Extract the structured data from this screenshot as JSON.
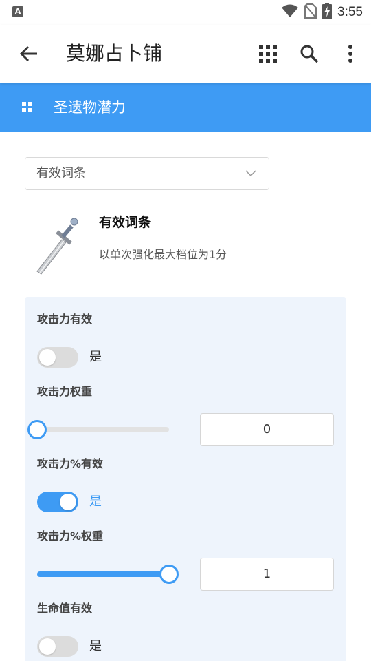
{
  "status_bar": {
    "time": "3:55",
    "notification_icon": "A",
    "icons": [
      "wifi-icon",
      "no-sim-icon",
      "battery-charging-icon"
    ]
  },
  "app_bar": {
    "title": "莫娜占卜铺",
    "icons": [
      "back-arrow-icon",
      "grid-icon",
      "search-icon",
      "more-vert-icon"
    ]
  },
  "section": {
    "title": "圣遗物潜力",
    "icon": "grid-small-icon"
  },
  "dropdown": {
    "value": "有效词条"
  },
  "info": {
    "title": "有效词条",
    "description": "以单次强化最大档位为1分"
  },
  "panel": {
    "rows": [
      {
        "label": "攻击力有效",
        "toggle_on": false,
        "toggle_text": "是"
      },
      {
        "label": "攻击力权重",
        "slider_value": 0,
        "input_value": "0"
      },
      {
        "label": "攻击力%有效",
        "toggle_on": true,
        "toggle_text": "是"
      },
      {
        "label": "攻击力%权重",
        "slider_value": 1,
        "input_value": "1"
      },
      {
        "label": "生命值有效",
        "toggle_on": false,
        "toggle_text": "是"
      }
    ]
  },
  "colors": {
    "accent": "#3e9bf4",
    "panel_bg": "#eef4fc",
    "toggle_off": "#dcdcdc"
  }
}
